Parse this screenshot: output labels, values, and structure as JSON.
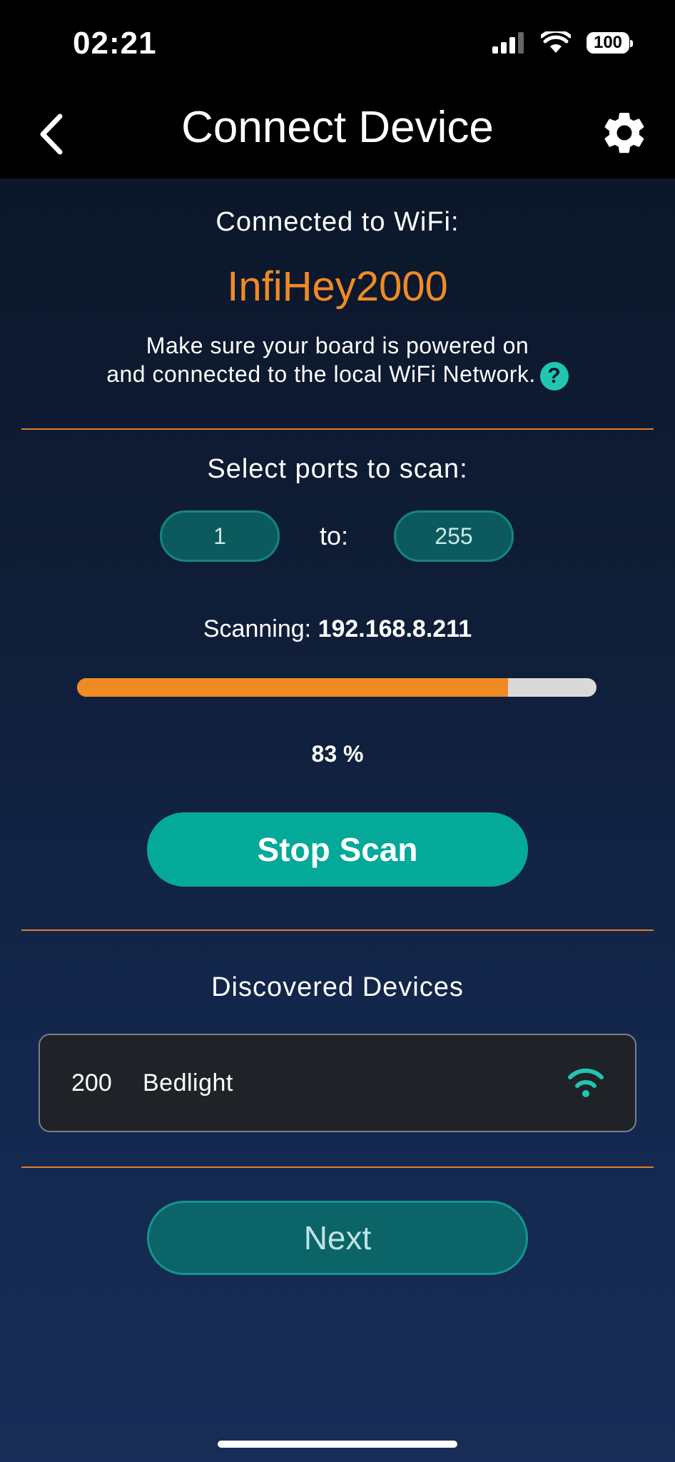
{
  "status_bar": {
    "time": "02:21",
    "battery": "100"
  },
  "nav": {
    "title": "Connect Device"
  },
  "wifi": {
    "label": "Connected to WiFi:",
    "name": "InfiHey2000",
    "info_line1": "Make sure your board is powered on",
    "info_line2": "and connected to the local WiFi Network.",
    "help_glyph": "?"
  },
  "ports": {
    "title": "Select ports to scan:",
    "from": "1",
    "to_label": "to:",
    "to": "255"
  },
  "scan": {
    "label": "Scanning:",
    "ip": "192.168.8.211",
    "progress": 0.83,
    "percent_text": "83 %",
    "stop_label": "Stop Scan"
  },
  "devices": {
    "title": "Discovered Devices",
    "items": [
      {
        "port": "200",
        "name": "Bedlight"
      }
    ]
  },
  "next_label": "Next",
  "colors": {
    "accent_orange": "#f08a24",
    "teal": "#05a99a"
  }
}
